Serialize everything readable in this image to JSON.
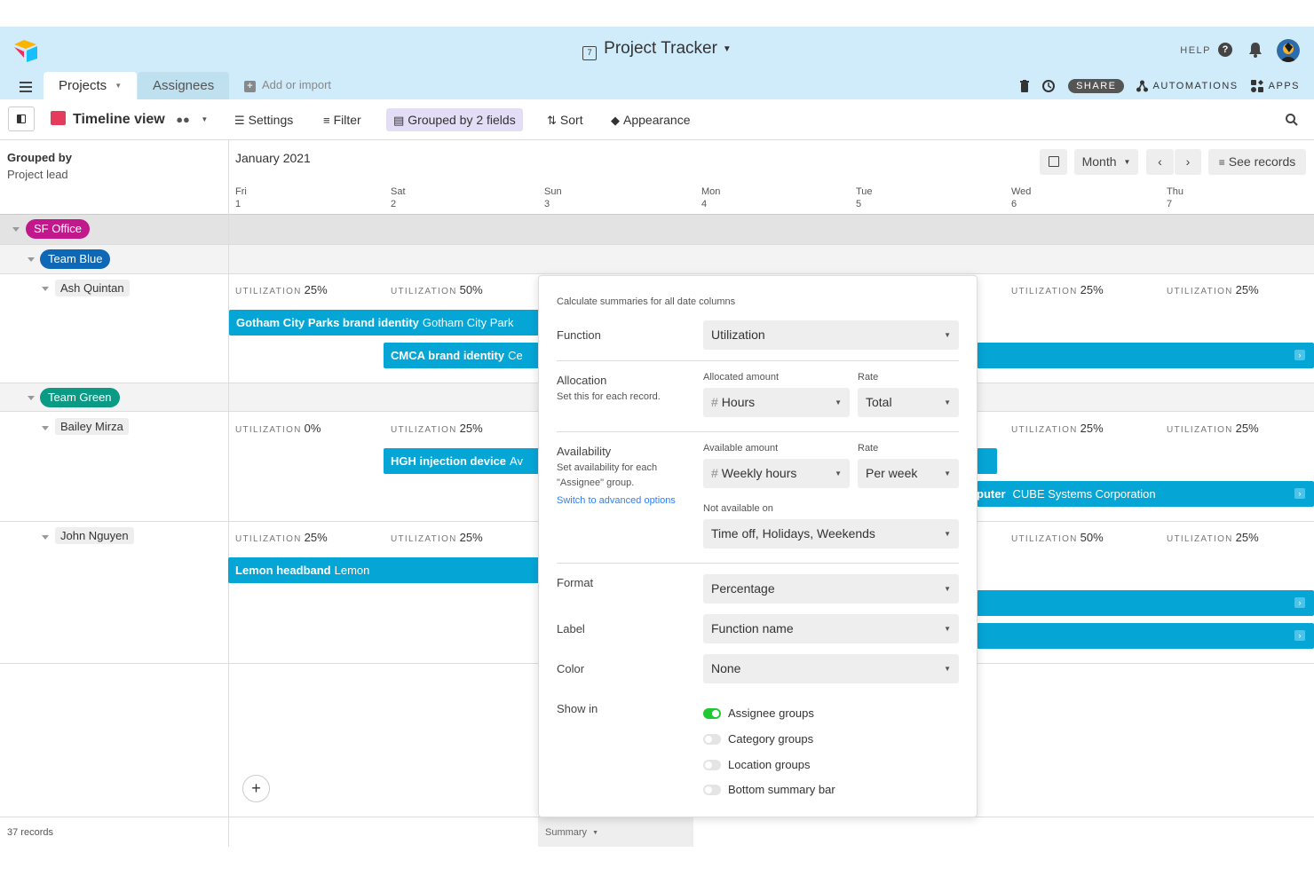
{
  "header": {
    "base_title": "Project Tracker",
    "help": "HELP",
    "tabs": [
      {
        "label": "Projects"
      },
      {
        "label": "Assignees"
      }
    ],
    "add_import": "Add or import",
    "share": "SHARE",
    "automations": "AUTOMATIONS",
    "apps": "APPS"
  },
  "viewbar": {
    "view_name": "Timeline view",
    "settings": "Settings",
    "filter": "Filter",
    "grouped": "Grouped by 2 fields",
    "sort": "Sort",
    "appearance": "Appearance"
  },
  "left": {
    "grouped_by": "Grouped by",
    "grouped_field": "Project lead",
    "records": "37 records"
  },
  "calendar": {
    "month": "January 2021",
    "range": "Month",
    "see_records": "See records",
    "days": [
      {
        "name": "Fri",
        "num": "1"
      },
      {
        "name": "Sat",
        "num": "2"
      },
      {
        "name": "Sun",
        "num": "3"
      },
      {
        "name": "Mon",
        "num": "4"
      },
      {
        "name": "Tue",
        "num": "5"
      },
      {
        "name": "Wed",
        "num": "6"
      },
      {
        "name": "Thu",
        "num": "7"
      }
    ]
  },
  "groups": {
    "office": "SF Office",
    "team_blue": "Team Blue",
    "team_green": "Team Green",
    "people": [
      "Ash Quintan",
      "Bailey Mirza",
      "John Nguyen"
    ]
  },
  "utilization": {
    "label": "UTILIZATION",
    "ash": [
      "25%",
      "50%",
      "25%",
      "25%"
    ],
    "bailey": [
      "0%",
      "25%",
      "25%",
      "25%"
    ],
    "john": [
      "25%",
      "25%",
      "50%",
      "25%"
    ]
  },
  "bars": [
    {
      "title": "Gotham City Parks brand identity",
      "sub": "Gotham City Park"
    },
    {
      "title": "CMCA brand identity",
      "sub": "Ce"
    },
    {
      "title": "HGH injection device",
      "sub": "Av"
    },
    {
      "title": "puter",
      "sub": "CUBE Systems Corporation"
    },
    {
      "title": "Lemon headband",
      "sub": "Lemon"
    }
  ],
  "footer": {
    "summary": "Summary"
  },
  "popup": {
    "intro": "Calculate summaries for all date columns",
    "function_label": "Function",
    "function_value": "Utilization",
    "allocation_label": "Allocation",
    "allocation_help": "Set this for each record.",
    "allocated_amount_label": "Allocated amount",
    "allocated_amount_value": "Hours",
    "rate_label": "Rate",
    "allocation_rate_value": "Total",
    "availability_label": "Availability",
    "availability_help_1": "Set availability for each",
    "availability_help_2": "\"Assignee\" group.",
    "advanced_link": "Switch to advanced options",
    "available_amount_label": "Available amount",
    "available_amount_value": "Weekly hours",
    "availability_rate_value": "Per week",
    "not_available_label": "Not available on",
    "not_available_value": "Time off, Holidays, Weekends",
    "format_label": "Format",
    "format_value": "Percentage",
    "label_label": "Label",
    "label_value": "Function name",
    "color_label": "Color",
    "color_value": "None",
    "show_in_label": "Show in",
    "toggles": [
      {
        "label": "Assignee groups",
        "on": true
      },
      {
        "label": "Category groups",
        "on": false
      },
      {
        "label": "Location groups",
        "on": false
      },
      {
        "label": "Bottom summary bar",
        "on": false
      }
    ]
  },
  "colors": {
    "header_bg": "#d0ecfa",
    "bar": "#05a5d6",
    "office_pill": "#c1198b",
    "team_blue_pill": "#0f68b5",
    "team_green_pill": "#0b9b84",
    "toggle_on": "#20c933"
  }
}
